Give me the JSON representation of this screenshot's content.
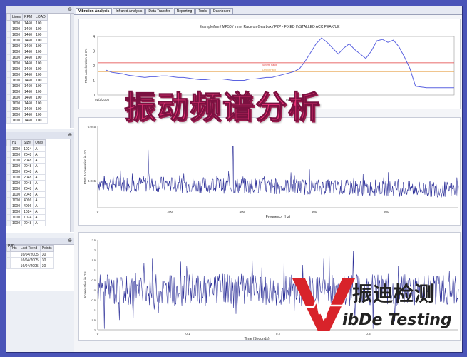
{
  "tabs": [
    {
      "label": "Vibration Analysis",
      "active": true
    },
    {
      "label": "Infrared Analysis",
      "active": false
    },
    {
      "label": "Data Transfer",
      "active": false
    },
    {
      "label": "Reporting",
      "active": false
    },
    {
      "label": "Tools",
      "active": false
    },
    {
      "label": "Dashboard",
      "active": false
    }
  ],
  "left_panels": {
    "pin_symbol": "⊕",
    "panel1": {
      "columns": [
        "Lines",
        "RPM",
        "LOAD"
      ],
      "rows": [
        [
          "1600",
          "1460",
          "100"
        ],
        [
          "1600",
          "1460",
          "100"
        ],
        [
          "1600",
          "1460",
          "100"
        ],
        [
          "1600",
          "1460",
          "100"
        ],
        [
          "1600",
          "1460",
          "100"
        ],
        [
          "1600",
          "1460",
          "100"
        ],
        [
          "1600",
          "1460",
          "100"
        ],
        [
          "1600",
          "1460",
          "100"
        ],
        [
          "1600",
          "1460",
          "100"
        ],
        [
          "1600",
          "1460",
          "100"
        ],
        [
          "1600",
          "1460",
          "100"
        ],
        [
          "1600",
          "1460",
          "100"
        ],
        [
          "1600",
          "1460",
          "100"
        ],
        [
          "1600",
          "1460",
          "100"
        ],
        [
          "1600",
          "1460",
          "100"
        ],
        [
          "1600",
          "1460",
          "100"
        ],
        [
          "1600",
          "1460",
          "100"
        ],
        [
          "1600",
          "1460",
          "100"
        ]
      ]
    },
    "panel2": {
      "columns": [
        "Hz",
        "Size",
        "Units"
      ],
      "rows": [
        [
          "1000",
          "1024",
          "A"
        ],
        [
          "1000",
          "2048",
          "A"
        ],
        [
          "1000",
          "2048",
          "A"
        ],
        [
          "1000",
          "2048",
          "A"
        ],
        [
          "1000",
          "2048",
          "A"
        ],
        [
          "1000",
          "2048",
          "A"
        ],
        [
          "1000",
          "2048",
          "A"
        ],
        [
          "1000",
          "2048",
          "A"
        ],
        [
          "1000",
          "2048",
          "A"
        ],
        [
          "1000",
          "4096",
          "A"
        ],
        [
          "1000",
          "4096",
          "A"
        ],
        [
          "1000",
          "1024",
          "A"
        ],
        [
          "1000",
          "1024",
          "A"
        ],
        [
          "1000",
          "2048",
          "A"
        ]
      ]
    },
    "panel3": {
      "title": "P2P",
      "columns": [
        "nts",
        "Last Trend",
        "Points"
      ],
      "rows": [
        [
          "",
          "16/04/2005",
          "30"
        ],
        [
          "",
          "16/04/2005",
          "30"
        ],
        [
          "",
          "16/04/2005",
          "30"
        ]
      ]
    }
  },
  "overlay": {
    "headline": "振动频谱分析",
    "brand_cn": "振迪检测",
    "brand_en": "ibDe Testing"
  },
  "colors": {
    "trace": "#2c2f98",
    "alarm_high": "#e03a3a",
    "alarm_low": "#e7a24a",
    "headline": "#e83377",
    "logo_red": "#d8232a"
  },
  "chart_data": [
    {
      "type": "line",
      "title": "Example/bm / MP50 / Inner Race on Gearbox / P2P - FIXED INSTALLED ACC PEAK/UE",
      "ylabel": "RMS Acceleration in G's",
      "ylim": [
        0,
        4
      ],
      "y_ticks": [
        "0",
        "1",
        "2",
        "3",
        "4"
      ],
      "x_ticks": [
        "01/2/2005",
        "01/2/2005"
      ],
      "annotations": [
        "Severe Fault",
        "Detect Fault"
      ],
      "thresholds": [
        {
          "name": "Severe Fault",
          "value": 2.2
        },
        {
          "name": "Detect Fault",
          "value": 1.6
        }
      ],
      "series": [
        {
          "values": [
            1.7,
            1.55,
            1.5,
            1.45,
            1.35,
            1.3,
            1.25,
            1.2,
            1.25,
            1.25,
            1.3,
            1.3,
            1.25,
            1.2,
            1.2,
            1.15,
            1.1,
            1.05,
            1.05,
            1.1,
            1.1,
            1.1,
            1.05,
            1.0,
            1.0,
            1.0,
            1.1,
            1.1,
            1.15,
            1.2,
            1.2,
            1.3,
            1.4,
            1.5,
            1.6,
            1.8,
            2.3,
            2.9,
            3.5,
            3.9,
            3.6,
            3.2,
            2.8,
            3.2,
            3.5,
            3.1,
            2.8,
            2.5,
            3.0,
            3.7,
            3.8,
            3.6,
            3.75,
            3.3,
            2.6,
            1.8,
            0.6,
            0.55,
            0.5,
            0.5,
            0.5,
            0.5,
            0.5,
            0.5
          ]
        }
      ]
    },
    {
      "type": "line",
      "xlabel": "Frequency (Hz)",
      "ylabel": "RMS Acceleration in G's",
      "xlim": [
        0,
        1000
      ],
      "ylim": [
        0,
        0.045
      ],
      "x_ticks": [
        "0",
        "200",
        "400",
        "600",
        "800"
      ],
      "y_ticks": [
        "0.015",
        "0.045"
      ],
      "peaks": [
        {
          "x": 140,
          "y": 0.032
        },
        {
          "x": 375,
          "y": 0.034
        }
      ]
    },
    {
      "type": "line",
      "xlabel": "Time (Seconds)",
      "ylabel": "Acceleration in G's",
      "xlim": [
        0,
        0.4
      ],
      "ylim": [
        -2,
        2.5
      ],
      "x_ticks": [
        "0",
        "0.1",
        "0.2",
        "0.3"
      ],
      "y_ticks": [
        "-2",
        "-1.5",
        "-1",
        "-0.5",
        "0",
        "0.5",
        "1",
        "1.5",
        "2",
        "2.5"
      ]
    }
  ]
}
